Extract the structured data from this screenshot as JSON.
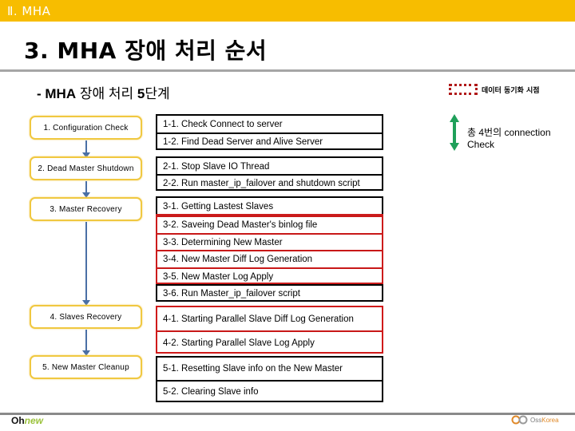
{
  "header": {
    "section": "Ⅱ. MHA",
    "title": "3. MHA 장애 처리 순서",
    "accent_color": "#f7bd00"
  },
  "subtitle": {
    "prefix": "- MHA",
    "korean": " 장애 처리 ",
    "suffix_num": "5",
    "suffix_text": "단계"
  },
  "legend": {
    "dotted_box_label": "데이터 동기화 시점",
    "dotted_box_color": "#b01818",
    "green_arrow_label": "총 4번의 connection Check",
    "green_arrow_color": "#1fa05a"
  },
  "phases": [
    {
      "label": "1. Configuration Check"
    },
    {
      "label": "2. Dead Master Shutdown"
    },
    {
      "label": "3. Master Recovery"
    },
    {
      "label": "4. Slaves Recovery"
    },
    {
      "label": "5. New Master Cleanup"
    }
  ],
  "steps": {
    "s1_1": "1-1. Check Connect to server",
    "s1_2": "1-2. Find Dead Server and Alive Server",
    "s2_1": "2-1. Stop Slave IO Thread",
    "s2_2": "2-2. Run master_ip_failover and shutdown script",
    "s3_1": "3-1. Getting Lastest Slaves",
    "s3_2": "3-2. Saveing Dead Master's binlog file",
    "s3_3": "3-3. Determining New Master",
    "s3_4": "3-4. New Master Diff Log Generation",
    "s3_5": "3-5. New Master Log Apply",
    "s3_6": "3-6. Run Master_ip_failover script",
    "s4_1": "4-1. Starting Parallel Slave Diff Log Generation",
    "s4_2": "4-2. Starting Parallel Slave Log Apply",
    "s5_1": "5-1. Resetting Slave info on the New Master",
    "s5_2": "5-2. Clearing Slave info"
  },
  "footer": {
    "left_logo_a": "Oh",
    "left_logo_b": "new",
    "right_logo_a": "Oss",
    "right_logo_b": "Korea"
  }
}
